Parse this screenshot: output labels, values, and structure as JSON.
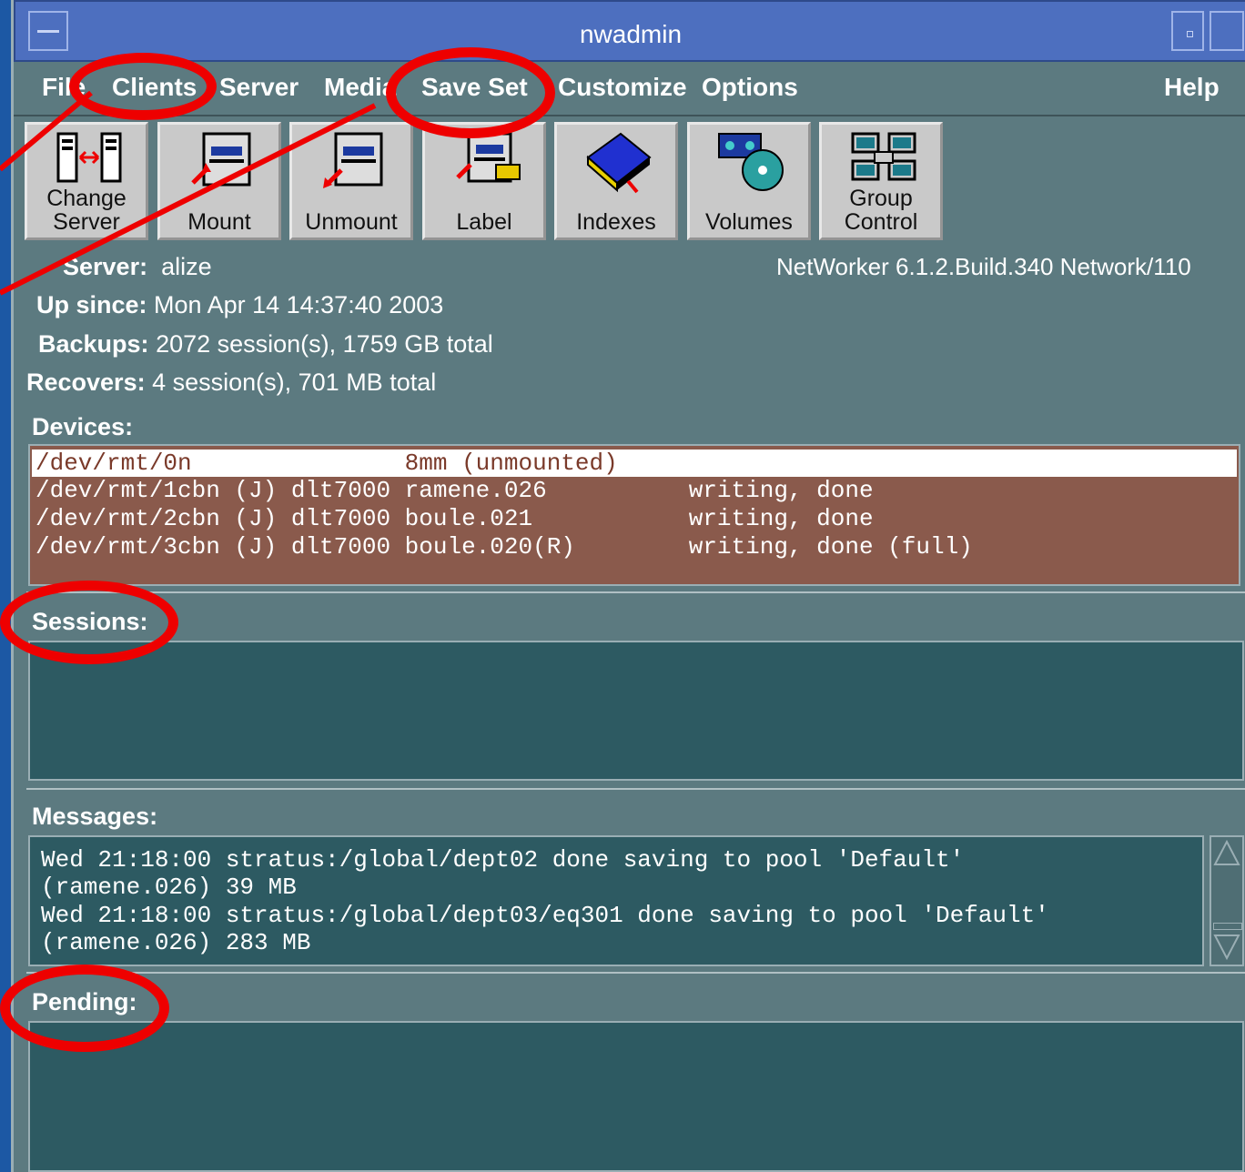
{
  "window": {
    "title": "nwadmin"
  },
  "menubar": [
    {
      "label": "File"
    },
    {
      "label": "Clients"
    },
    {
      "label": "Server"
    },
    {
      "label": "Media"
    },
    {
      "label": "Save Set"
    },
    {
      "label": "Customize"
    },
    {
      "label": "Options"
    },
    {
      "label": "Help"
    }
  ],
  "toolbar": [
    {
      "label": "Change\nServer",
      "icon": "change-server-icon"
    },
    {
      "label": "Mount",
      "icon": "mount-icon"
    },
    {
      "label": "Unmount",
      "icon": "unmount-icon"
    },
    {
      "label": "Label",
      "icon": "label-icon"
    },
    {
      "label": "Indexes",
      "icon": "indexes-icon"
    },
    {
      "label": "Volumes",
      "icon": "volumes-icon"
    },
    {
      "label": "Group\nControl",
      "icon": "group-control-icon"
    }
  ],
  "info": {
    "server_label": "Server:",
    "server_value": "alize",
    "version": "NetWorker 6.1.2.Build.340 Network/110",
    "upsince_label": "Up since:",
    "upsince_value": "Mon Apr 14 14:37:40 2003",
    "backups_label": "Backups:",
    "backups_value": "2072 session(s), 1759 GB total",
    "recovers_label": "Recovers:",
    "recovers_value": "4 session(s), 701 MB total"
  },
  "sections": {
    "devices": "Devices:",
    "sessions": "Sessions:",
    "messages": "Messages:",
    "pending": "Pending:"
  },
  "devices": [
    "/dev/rmt/0n               8mm (unmounted)",
    "/dev/rmt/1cbn (J) dlt7000 ramene.026          writing, done",
    "/dev/rmt/2cbn (J) dlt7000 boule.021           writing, done",
    "/dev/rmt/3cbn (J) dlt7000 boule.020(R)        writing, done (full)"
  ],
  "messages": [
    "Wed 21:18:00 stratus:/global/dept02 done saving to pool 'Default'",
    "(ramene.026) 39 MB",
    "Wed 21:18:00 stratus:/global/dept03/eq301 done saving to pool 'Default'",
    "(ramene.026) 283 MB"
  ],
  "colors": {
    "annotation": "#ee0000",
    "device_panel": "#8a5a4c",
    "panel": "#2d5a62",
    "titlebar": "#4d6fbf"
  }
}
